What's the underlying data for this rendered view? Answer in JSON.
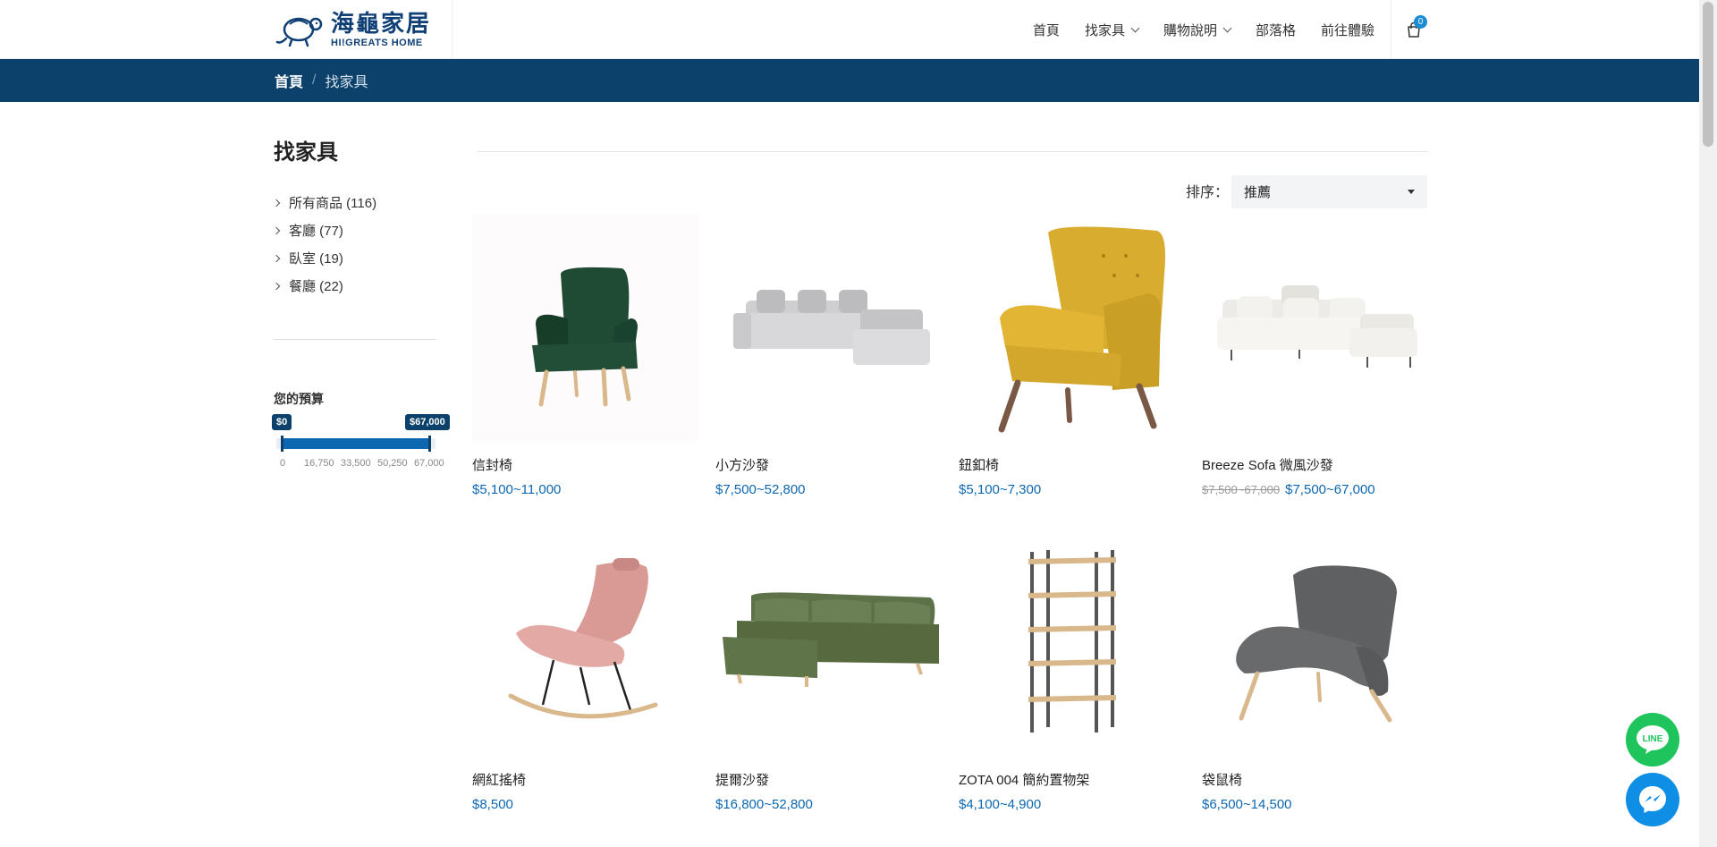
{
  "logo": {
    "cn": "海龜家居",
    "en": "HI!GREATS HOME"
  },
  "nav": {
    "items": [
      {
        "label": "首頁"
      },
      {
        "label": "找家具"
      },
      {
        "label": "購物說明"
      },
      {
        "label": "部落格"
      },
      {
        "label": "前往體驗"
      }
    ],
    "cart_count": "0"
  },
  "breadcrumb": {
    "home": "首頁",
    "separator": "/",
    "current": "找家具"
  },
  "sidebar": {
    "title": "找家具",
    "categories": [
      {
        "label": "所有商品 (116)"
      },
      {
        "label": "客廳 (77)"
      },
      {
        "label": "臥室 (19)"
      },
      {
        "label": "餐廳 (22)"
      }
    ],
    "budget": {
      "label": "您的預算",
      "min_label": "$0",
      "max_label": "$67,000",
      "min": 0,
      "max": 67000,
      "selected_min": 0,
      "selected_max": 67000,
      "ticks": [
        "0",
        "16,750",
        "33,500",
        "50,250",
        "67,000"
      ]
    }
  },
  "sort": {
    "label": "排序：",
    "value": "推薦"
  },
  "products": [
    {
      "name": "信封椅",
      "price": "$5,100~11,000",
      "old_price": ""
    },
    {
      "name": "小方沙發",
      "price": "$7,500~52,800",
      "old_price": ""
    },
    {
      "name": "鈕釦椅",
      "price": "$5,100~7,300",
      "old_price": ""
    },
    {
      "name": "Breeze Sofa 微風沙發",
      "price": "$7,500~67,000",
      "old_price": "$7,500~67,000"
    },
    {
      "name": "網紅搖椅",
      "price": "$8,500",
      "old_price": ""
    },
    {
      "name": "提爾沙發",
      "price": "$16,800~52,800",
      "old_price": ""
    },
    {
      "name": "ZOTA 004 簡約置物架",
      "price": "$4,100~4,900",
      "old_price": ""
    },
    {
      "name": "袋鼠椅",
      "price": "$6,500~14,500",
      "old_price": ""
    }
  ],
  "floating": {
    "line_label": "LINE"
  },
  "colors": {
    "brand_navy": "#0b416a",
    "price_blue": "#0d67b0",
    "line_green": "#1fc55c",
    "messenger_blue": "#0e8ee4"
  }
}
